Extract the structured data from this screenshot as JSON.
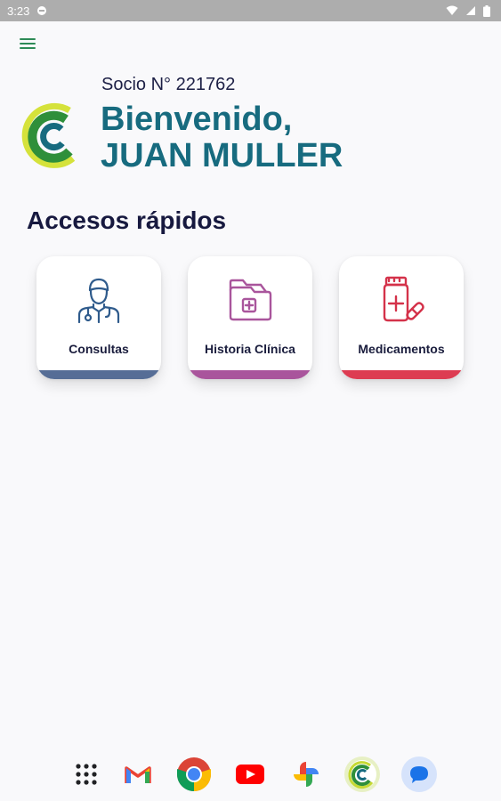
{
  "status_bar": {
    "time": "3:23",
    "icons": [
      "notification-icon",
      "wifi-icon",
      "signal-icon",
      "battery-icon"
    ]
  },
  "header": {
    "menu_icon": "hamburger-menu-icon",
    "member_number": "Socio N° 221762",
    "welcome_line1": "Bienvenido,",
    "welcome_line2": "JUAN MULLER"
  },
  "quick_access": {
    "title": "Accesos rápidos",
    "items": [
      {
        "label": "Consultas",
        "icon": "doctor-icon",
        "color": "#566d96"
      },
      {
        "label": "Historia Clínica",
        "icon": "medical-folder-icon",
        "color": "#a9559c"
      },
      {
        "label": "Medicamentos",
        "icon": "medicine-bottle-icon",
        "color": "#dd3c52"
      }
    ]
  },
  "dock": {
    "apps": [
      "apps-grid-icon",
      "gmail-icon",
      "chrome-icon",
      "youtube-icon",
      "photos-icon",
      "app-logo-icon",
      "messages-icon"
    ]
  },
  "colors": {
    "brand_teal": "#176b7f",
    "brand_green": "#2e8b57",
    "brand_lime": "#c6d933",
    "text_navy": "#17193f"
  }
}
